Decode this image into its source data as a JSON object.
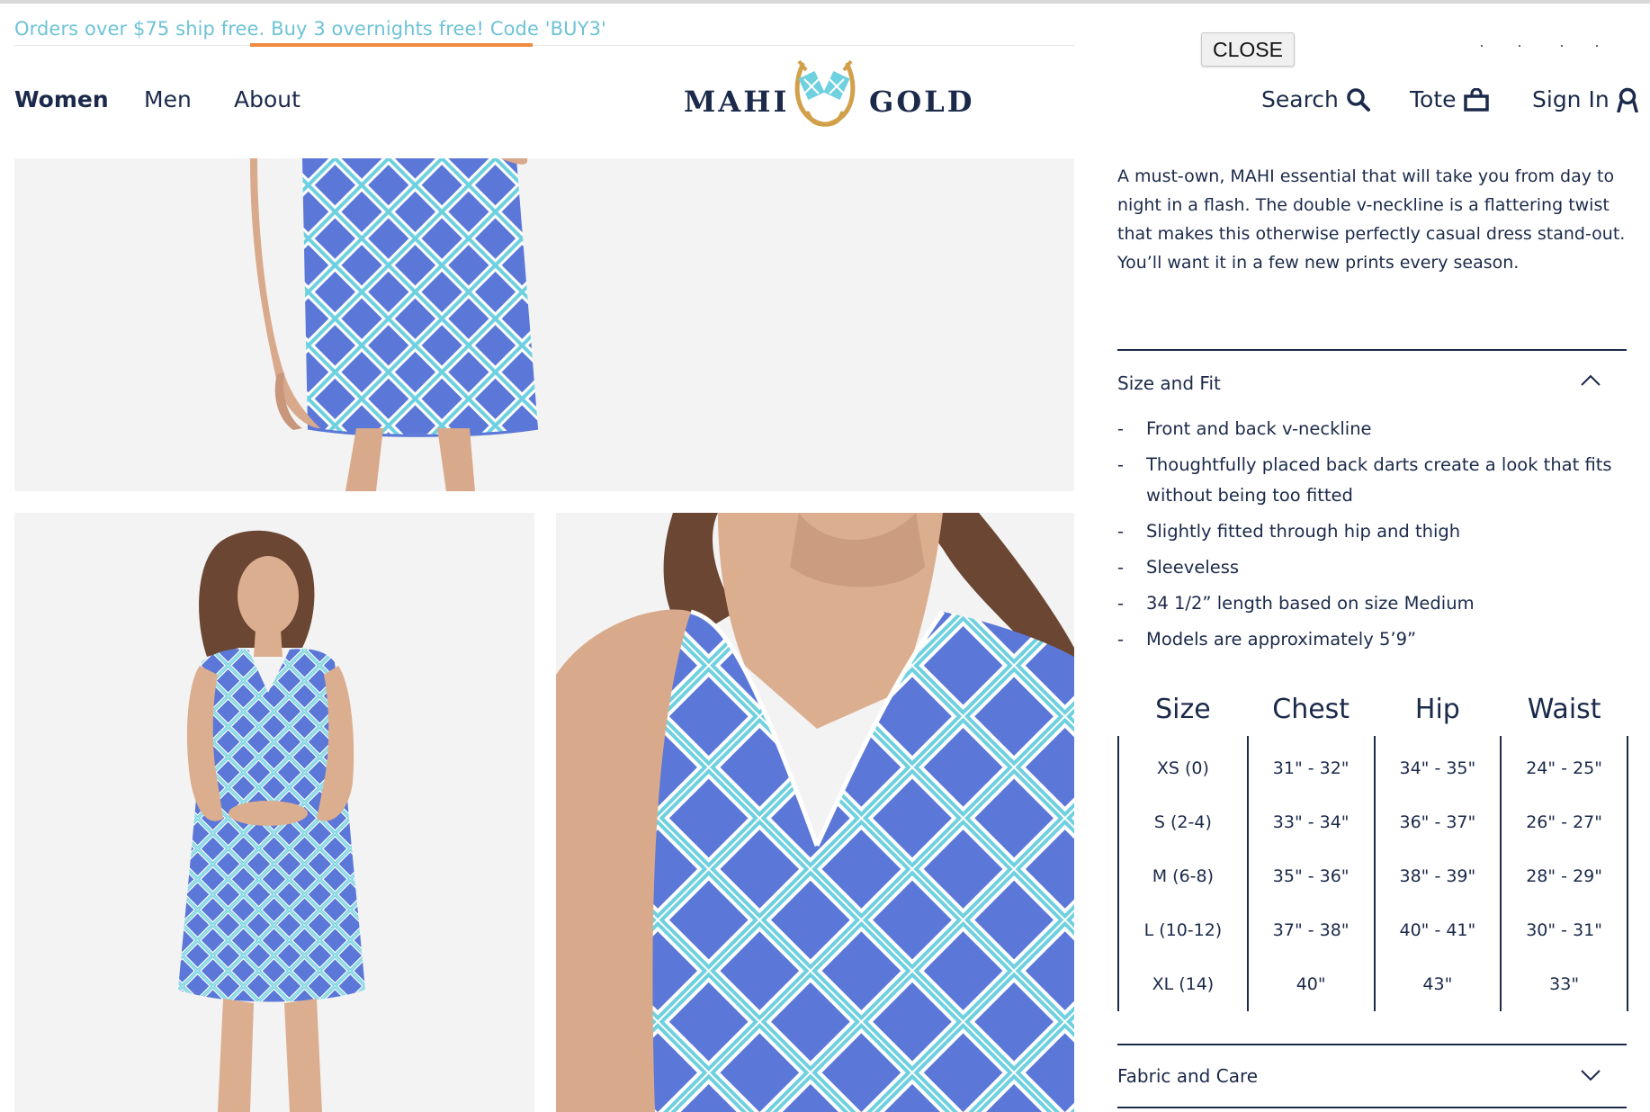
{
  "promo": {
    "text": "Orders over $75 ship free. Buy 3 overnights free! Code 'BUY3'"
  },
  "nav": {
    "women": "Women",
    "men": "Men",
    "about": "About"
  },
  "logo": {
    "left": "MAHI",
    "right": "GOLD"
  },
  "utility": {
    "search": "Search",
    "tote": "Tote",
    "sign_in": "Sign In"
  },
  "overlay": {
    "close": "CLOSE"
  },
  "description": "A must-own, MAHI essential that will take you from day to night in a flash. The double v-neckline is a flattering twist that makes this otherwise perfectly casual dress stand-out. You’ll want it in a few new prints every season.",
  "size_fit": {
    "title": "Size and Fit",
    "bullets": [
      "Front and back v-neckline",
      "Thoughtfully placed back darts create a look that fits without being too fitted",
      "Slightly fitted through hip and thigh",
      "Sleeveless",
      "34 1/2” length based on size Medium",
      "Models are approximately 5’9”"
    ],
    "table": {
      "headers": [
        "Size",
        "Chest",
        "Hip",
        "Waist"
      ],
      "rows": [
        [
          "XS (0)",
          "31\" - 32\"",
          "34\" - 35\"",
          "24\" - 25\""
        ],
        [
          "S (2-4)",
          "33\" - 34\"",
          "36\" - 37\"",
          "26\" - 27\""
        ],
        [
          "M (6-8)",
          "35\" - 36\"",
          "38\" - 39\"",
          "28\" - 29\""
        ],
        [
          "L (10-12)",
          "37\" - 38\"",
          "40\" - 41\"",
          "30\" - 31\""
        ],
        [
          "XL (14)",
          "40\"",
          "43\"",
          "33\""
        ]
      ]
    }
  },
  "fabric_care": {
    "title": "Fabric and Care"
  },
  "colors": {
    "navy": "#1b2a4a",
    "promo": "#6ec3d6",
    "gold": "#d2a04a",
    "teal": "#6fd0df",
    "dress_blue": "#5b78d8"
  }
}
